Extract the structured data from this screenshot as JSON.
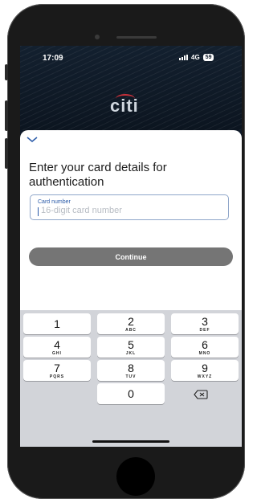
{
  "status": {
    "time": "17:09",
    "network": "4G",
    "battery": "59"
  },
  "brand": {
    "logo_text": "citi"
  },
  "sheet": {
    "title": "Enter your card details for authentication",
    "card_field": {
      "label": "Card number",
      "placeholder": "16-digit card number",
      "value": ""
    },
    "continue_label": "Continue"
  },
  "keypad": {
    "keys": [
      {
        "digit": "1",
        "letters": ""
      },
      {
        "digit": "2",
        "letters": "ABC"
      },
      {
        "digit": "3",
        "letters": "DEF"
      },
      {
        "digit": "4",
        "letters": "GHI"
      },
      {
        "digit": "5",
        "letters": "JKL"
      },
      {
        "digit": "6",
        "letters": "MNO"
      },
      {
        "digit": "7",
        "letters": "PQRS"
      },
      {
        "digit": "8",
        "letters": "TUV"
      },
      {
        "digit": "9",
        "letters": "WXYZ"
      },
      {
        "digit": "0",
        "letters": ""
      }
    ],
    "delete_icon": "backspace-icon"
  },
  "colors": {
    "accent": "#2a5aa8",
    "button": "#757575",
    "logo_arc": "#c9303a"
  }
}
